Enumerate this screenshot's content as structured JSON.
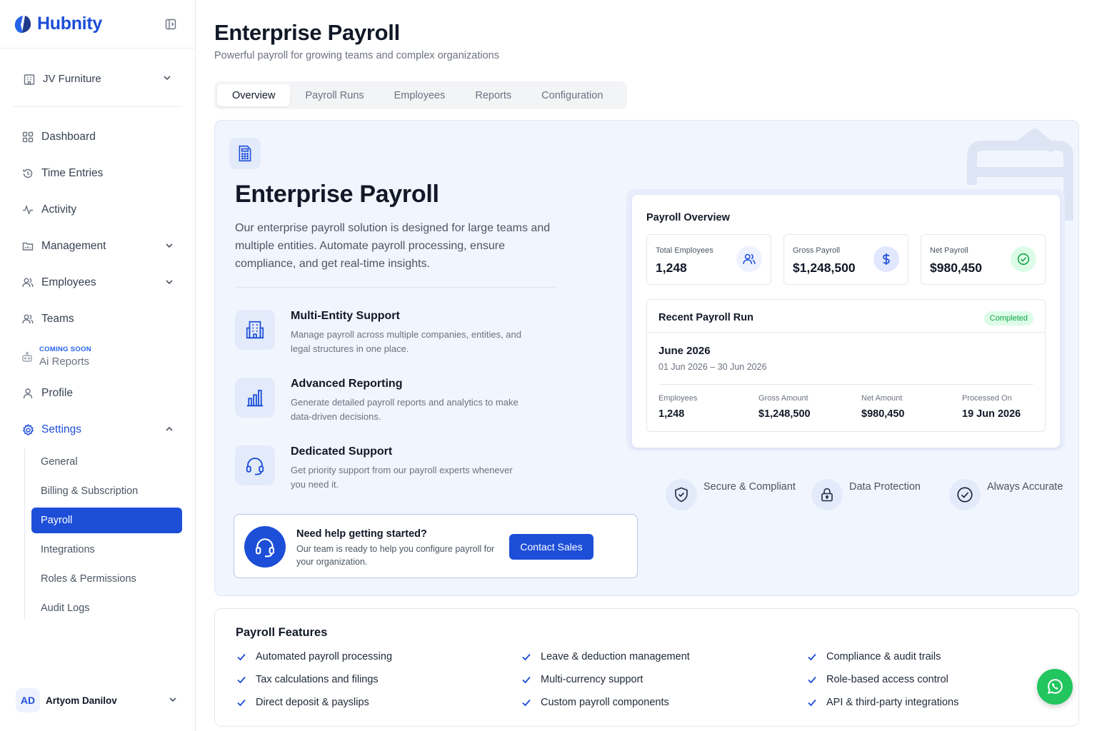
{
  "brand": {
    "name": "Hubnity"
  },
  "org": {
    "name": "JV Furniture"
  },
  "nav": {
    "items": [
      {
        "label": "Dashboard"
      },
      {
        "label": "Time Entries"
      },
      {
        "label": "Activity"
      },
      {
        "label": "Management"
      },
      {
        "label": "Employees"
      },
      {
        "label": "Teams"
      },
      {
        "label": "Ai Reports",
        "tag": "COMING SOON"
      },
      {
        "label": "Profile"
      },
      {
        "label": "Settings"
      }
    ],
    "settings_sub": [
      "General",
      "Billing & Subscription",
      "Payroll",
      "Integrations",
      "Roles & Permissions",
      "Audit Logs"
    ]
  },
  "user": {
    "initials": "AD",
    "name": "Artyom Danilov"
  },
  "page": {
    "title": "Enterprise Payroll",
    "subtitle": "Powerful payroll for growing teams and complex organizations"
  },
  "tabs": [
    "Overview",
    "Payroll Runs",
    "Employees",
    "Reports",
    "Configuration"
  ],
  "hero": {
    "title": "Enterprise Payroll",
    "description": "Our enterprise payroll solution is designed for large teams and multiple entities. Automate payroll processing, ensure compliance, and get real-time insights.",
    "features": [
      {
        "title": "Multi-Entity Support",
        "desc": "Manage payroll across multiple companies, entities, and legal structures in one place."
      },
      {
        "title": "Advanced Reporting",
        "desc": "Generate detailed payroll reports and analytics to make data-driven decisions."
      },
      {
        "title": "Dedicated Support",
        "desc": "Get priority support from our payroll experts whenever you need it."
      }
    ],
    "help": {
      "title": "Need help getting started?",
      "desc": "Our team is ready to help you configure payroll for your organization.",
      "button": "Contact Sales"
    }
  },
  "overview": {
    "title": "Payroll Overview",
    "stats": [
      {
        "label": "Total Employees",
        "value": "1,248"
      },
      {
        "label": "Gross Payroll",
        "value": "$1,248,500"
      },
      {
        "label": "Net Payroll",
        "value": "$980,450"
      }
    ],
    "recent": {
      "title": "Recent Payroll Run",
      "status": "Completed",
      "month": "June 2026",
      "range": "01 Jun 2026 – 30 Jun 2026",
      "cols": [
        {
          "label": "Employees",
          "value": "1,248"
        },
        {
          "label": "Gross Amount",
          "value": "$1,248,500"
        },
        {
          "label": "Net Amount",
          "value": "$980,450"
        },
        {
          "label": "Processed On",
          "value": "19 Jun 2026"
        }
      ]
    }
  },
  "trust": [
    "Secure & Compliant",
    "Data Protection",
    "Always Accurate"
  ],
  "payroll_features": {
    "title": "Payroll Features",
    "items": [
      "Automated payroll processing",
      "Leave & deduction management",
      "Compliance & audit trails",
      "Tax calculations and filings",
      "Multi-currency support",
      "Role-based access control",
      "Direct deposit & payslips",
      "Custom payroll components",
      "API & third-party integrations"
    ]
  },
  "colors": {
    "primary": "#1d4ed8",
    "success": "#16a34a",
    "hero_bg": "#f1f5fd"
  }
}
